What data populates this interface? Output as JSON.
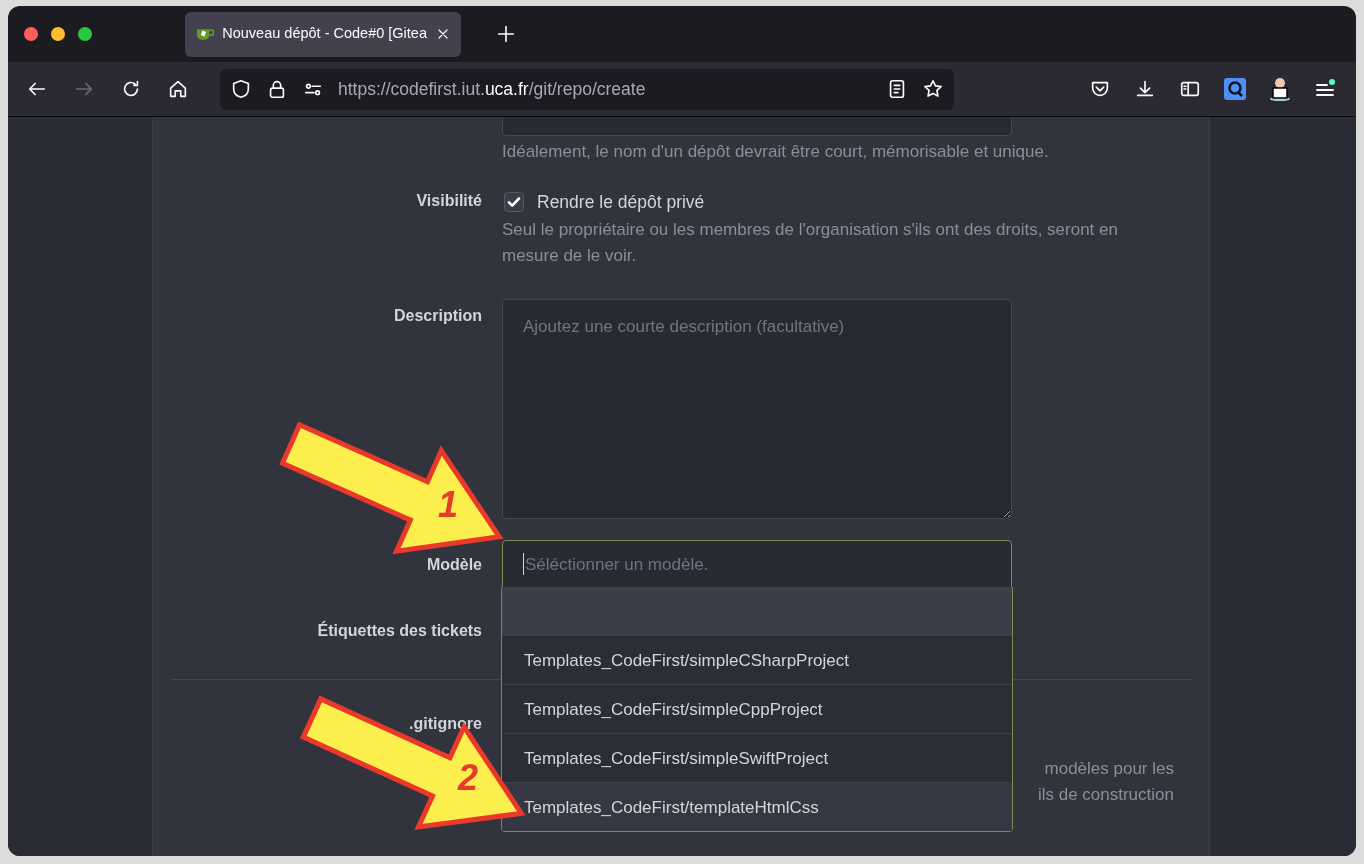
{
  "browser": {
    "tab": {
      "title": "Nouveau dépôt - Code#0 [Gitea",
      "selected": true
    },
    "nav": {
      "forward_disabled": true
    },
    "url_parts": [
      {
        "text": "https://codefirst.iut.",
        "emphasized": false
      },
      {
        "text": "uca.fr",
        "emphasized": true
      },
      {
        "text": "/git/repo/create",
        "emphasized": false
      }
    ]
  },
  "form": {
    "name_help": "Idéalement, le nom d'un dépôt devrait être court, mémorisable et unique.",
    "visibility": {
      "label": "Visibilité",
      "checkbox_label": "Rendre le dépôt privé",
      "checked": true,
      "help": "Seul le propriétaire ou les membres de l'organisation s'ils ont des droits, seront en mesure de le voir."
    },
    "description": {
      "label": "Description",
      "placeholder": "Ajoutez une courte description (facultative)"
    },
    "template": {
      "label": "Modèle",
      "placeholder": "Séléctionner un modèle.",
      "options": [
        {
          "selected": true,
          "hovered": false
        },
        {
          "label": "Templates_CodeFirst/simpleCSharpProject",
          "selected": false,
          "hovered": false
        },
        {
          "label": "Templates_CodeFirst/simpleCppProject",
          "selected": false,
          "hovered": false
        },
        {
          "label": "Templates_CodeFirst/simpleSwiftProject",
          "selected": false,
          "hovered": false
        },
        {
          "label": "Templates_CodeFirst/templateHtmlCss",
          "selected": false,
          "hovered": true
        }
      ]
    },
    "issue_labels": {
      "label": "Étiquettes des tickets"
    },
    "gitignore": {
      "label": ".gitignore",
      "help_lines": [
        "modèles pour les",
        "ils de construction"
      ]
    }
  },
  "annotations": [
    {
      "label": "1"
    },
    {
      "label": "2"
    }
  ]
}
